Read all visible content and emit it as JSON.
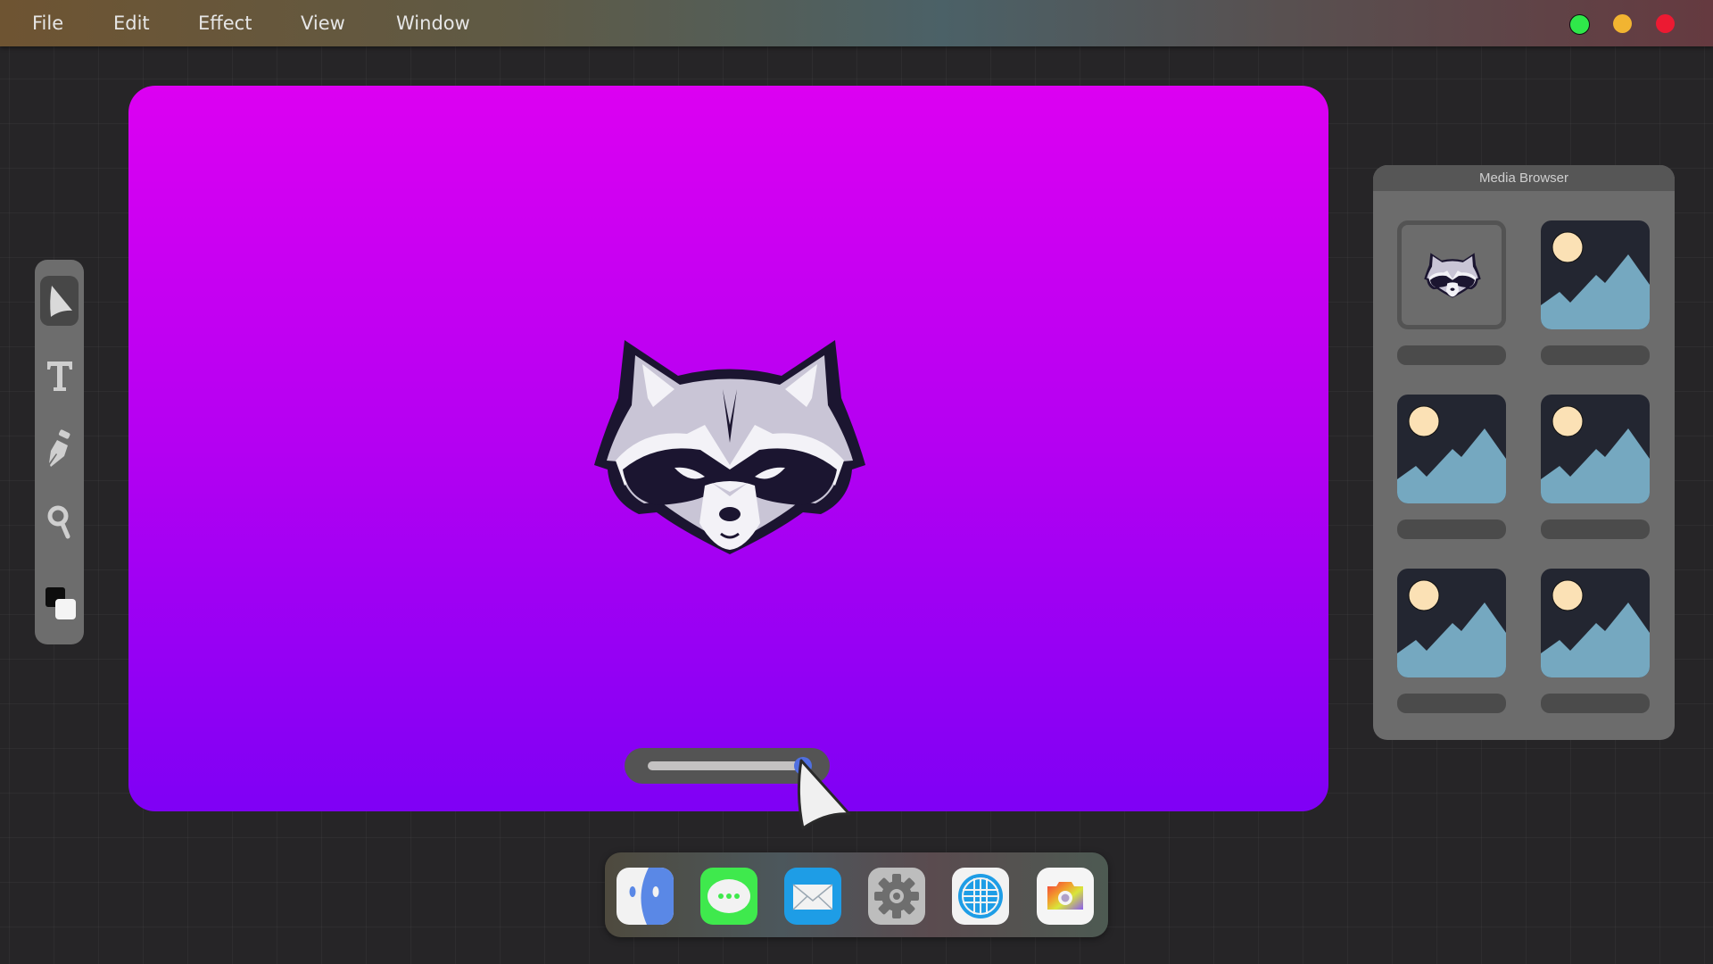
{
  "menubar": {
    "items": [
      "File",
      "Edit",
      "Effect",
      "View",
      "Window"
    ],
    "window_controls": [
      {
        "name": "maximize",
        "color": "#2fe84a"
      },
      {
        "name": "minimize",
        "color": "#f2b431"
      },
      {
        "name": "close",
        "color": "#ec1a32"
      }
    ]
  },
  "canvas": {
    "gradient_top": "#dc00f2",
    "gradient_bottom": "#7f00f5",
    "image": "raccoon-logo",
    "slider": {
      "value_percent": 98,
      "knob_color": "#4f6fe0"
    }
  },
  "toolbar": {
    "tools": [
      {
        "name": "select-tool",
        "icon": "pointer-arrow-icon",
        "active": true
      },
      {
        "name": "text-tool",
        "icon": "text-T-icon",
        "active": false
      },
      {
        "name": "pen-tool",
        "icon": "pen-nib-icon",
        "active": false
      },
      {
        "name": "zoom-tool",
        "icon": "magnifier-icon",
        "active": false
      },
      {
        "name": "color-swatch",
        "icon": "fill-stroke-swatch-icon",
        "active": false
      }
    ]
  },
  "media_browser": {
    "title": "Media Browser",
    "items": [
      {
        "type": "raccoon-logo",
        "selected": true
      },
      {
        "type": "image-placeholder",
        "selected": false
      },
      {
        "type": "image-placeholder",
        "selected": false
      },
      {
        "type": "image-placeholder",
        "selected": false
      },
      {
        "type": "image-placeholder",
        "selected": false
      },
      {
        "type": "image-placeholder",
        "selected": false
      }
    ]
  },
  "dock": {
    "apps": [
      "Finder",
      "Messages",
      "Mail",
      "Settings",
      "Browser",
      "Camera"
    ]
  }
}
